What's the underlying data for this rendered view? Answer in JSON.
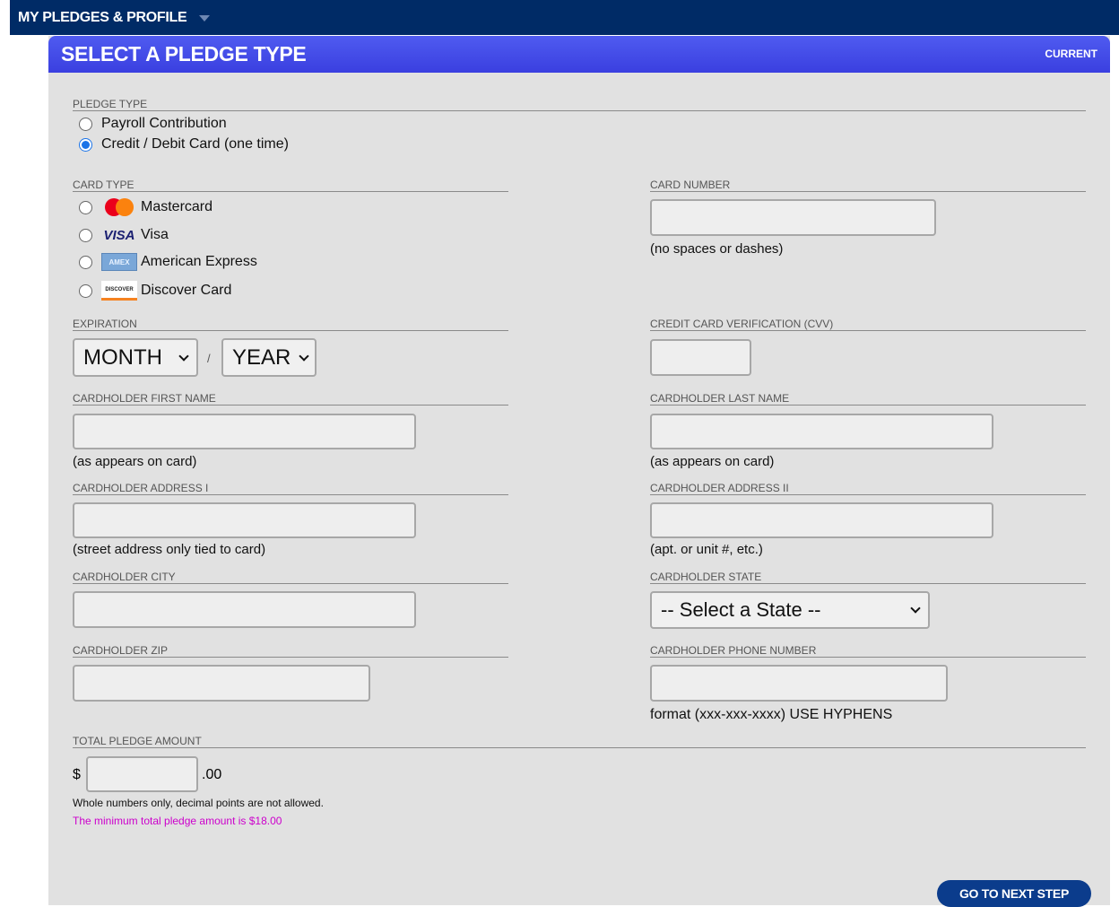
{
  "top_nav": {
    "title": "MY PLEDGES & PROFILE"
  },
  "panel": {
    "title": "SELECT A PLEDGE TYPE",
    "status": "CURRENT"
  },
  "pledge_type": {
    "label": "PLEDGE TYPE",
    "options": [
      {
        "label": "Payroll Contribution",
        "selected": false
      },
      {
        "label": "Credit / Debit Card (one time)",
        "selected": true
      }
    ]
  },
  "card_type": {
    "label": "CARD TYPE",
    "options": [
      {
        "label": "Mastercard",
        "icon": "mastercard-logo"
      },
      {
        "label": "Visa",
        "icon": "visa-logo",
        "logo_text": "VISA"
      },
      {
        "label": "American Express",
        "icon": "amex-logo",
        "logo_text": "AMEX"
      },
      {
        "label": "Discover Card",
        "icon": "discover-logo",
        "logo_text": "DISCOVER"
      }
    ]
  },
  "card_number": {
    "label": "CARD NUMBER",
    "value": "",
    "hint": "(no spaces or dashes)"
  },
  "expiration": {
    "label": "EXPIRATION",
    "month": "MONTH",
    "separator": "/",
    "year": "YEAR"
  },
  "cvv": {
    "label": "CREDIT CARD VERIFICATION (CVV)",
    "value": ""
  },
  "first_name": {
    "label": "CARDHOLDER FIRST NAME",
    "value": "",
    "hint": "(as appears on card)"
  },
  "last_name": {
    "label": "CARDHOLDER LAST NAME",
    "value": "",
    "hint": "(as appears on card)"
  },
  "address1": {
    "label": "CARDHOLDER ADDRESS I",
    "value": "",
    "hint": "(street address only tied to card)"
  },
  "address2": {
    "label": "CARDHOLDER ADDRESS II",
    "value": "",
    "hint": "(apt. or unit #, etc.)"
  },
  "city": {
    "label": "CARDHOLDER CITY",
    "value": ""
  },
  "state": {
    "label": "CARDHOLDER STATE",
    "selected": "-- Select a State --"
  },
  "zip": {
    "label": "CARDHOLDER ZIP",
    "value": ""
  },
  "phone": {
    "label": "CARDHOLDER PHONE NUMBER",
    "value": "",
    "hint": "format (xxx-xxx-xxxx) USE HYPHENS"
  },
  "total": {
    "label": "TOTAL PLEDGE AMOUNT",
    "currency": "$",
    "suffix": ".00",
    "value": "",
    "note": "Whole numbers only, decimal points are not allowed.",
    "minimum_note": "The minimum total pledge amount is $18.00",
    "minimum_color": "#cc00cc"
  },
  "actions": {
    "next_label": "GO TO NEXT STEP"
  }
}
